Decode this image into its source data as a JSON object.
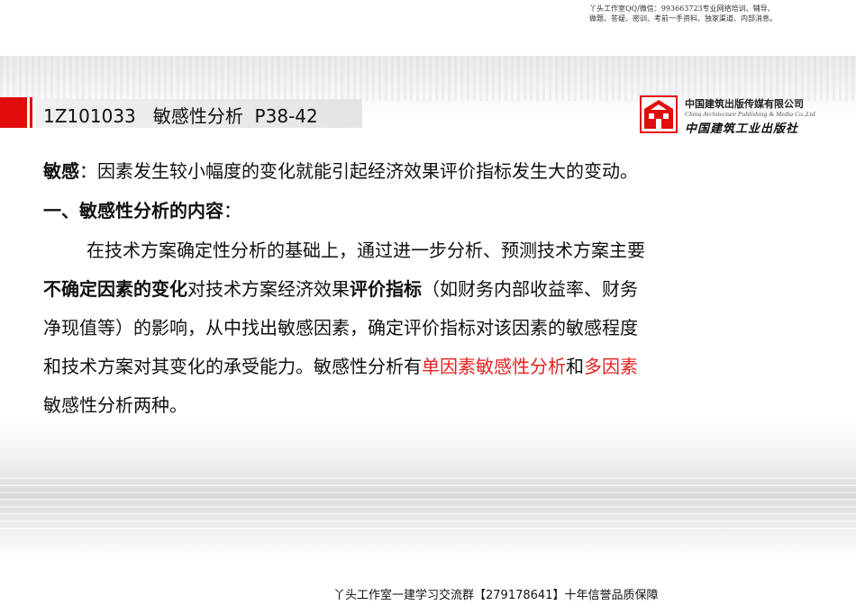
{
  "top_note": {
    "line1": "丫头工作室QQ/微信：993663723专业网络培训、辅导、",
    "line2": "做题、答疑、密训、考前一手资料、独家渠道、内部消息。"
  },
  "title": "1Z101033   敏感性分析  P38-42",
  "logo": {
    "name_cn": "中国建筑出版传媒有限公司",
    "name_en": "China Architecture Publishing & Media Co.,Ltd",
    "calligraphy": "中国建筑工业出版社"
  },
  "content": {
    "p1_term": "敏感",
    "p1_rest": "：因素发生较小幅度的变化就能引起经济效果评价指标发生大的变动。",
    "h1": "一、敏感性分析的内容",
    "h1_colon": "：",
    "p2_l1": "在技术方案确定性分析的基础上，通过进一步分析、预测技术方案主要",
    "p2_l2_b1": "不确定因素的变化",
    "p2_l2_t1": "对技术方案经济效果",
    "p2_l2_b2": "评价指标",
    "p2_l2_t2": "（如财务内部收益率、财务",
    "p2_l3": "净现值等）的影响，从中找出敏感因素，确定评价指标对该因素的敏感程度",
    "p2_l4_t1": "和技术方案对其变化的承受能力。敏感性分析有",
    "p2_l4_r1": "单因素敏感性分析",
    "p2_l4_t2": "和",
    "p2_l4_r2": "多因素",
    "p2_l5": "敏感性分析两种。"
  },
  "footer": "丫头工作室一建学习交流群【279178641】十年信誉品质保障",
  "colors": {
    "accent_red": "#e10c0c",
    "highlight_red": "#e61f1f"
  }
}
